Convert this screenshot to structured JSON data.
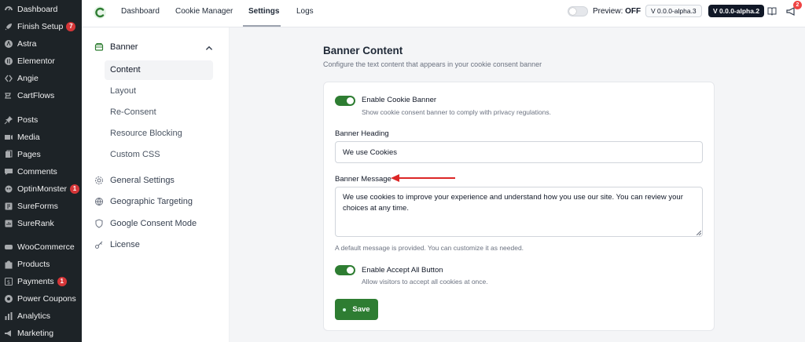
{
  "wp_sidebar": {
    "items": [
      {
        "label": "Dashboard",
        "icon": "dashboard-icon"
      },
      {
        "label": "Finish Setup",
        "icon": "rocket-icon",
        "badge": "7"
      },
      {
        "label": "Astra",
        "icon": "astra-icon"
      },
      {
        "label": "Elementor",
        "icon": "elementor-icon"
      },
      {
        "label": "Angie",
        "icon": "angie-icon"
      },
      {
        "label": "CartFlows",
        "icon": "cartflows-icon"
      },
      {
        "label": "Posts",
        "icon": "pin-icon"
      },
      {
        "label": "Media",
        "icon": "media-icon"
      },
      {
        "label": "Pages",
        "icon": "pages-icon"
      },
      {
        "label": "Comments",
        "icon": "comment-icon"
      },
      {
        "label": "OptinMonster",
        "icon": "optinmonster-icon",
        "badge": "1"
      },
      {
        "label": "SureForms",
        "icon": "sureforms-icon"
      },
      {
        "label": "SureRank",
        "icon": "surerank-icon"
      },
      {
        "label": "WooCommerce",
        "icon": "woocommerce-icon"
      },
      {
        "label": "Products",
        "icon": "products-icon"
      },
      {
        "label": "Payments",
        "icon": "payments-icon",
        "badge": "1"
      },
      {
        "label": "Power Coupons",
        "icon": "coupon-icon"
      },
      {
        "label": "Analytics",
        "icon": "analytics-icon"
      },
      {
        "label": "Marketing",
        "icon": "megaphone-icon"
      }
    ]
  },
  "topbar": {
    "tabs": [
      "Dashboard",
      "Cookie Manager",
      "Settings",
      "Logs"
    ],
    "active_tab": "Settings",
    "preview_label": "Preview:",
    "preview_state": "OFF",
    "version_current": "V 0.0.0-alpha.3",
    "version_latest": "V 0.0.0-alpha.2",
    "notification_count": "2"
  },
  "settings_nav": {
    "group": {
      "label": "Banner",
      "icon": "banner-icon"
    },
    "sub_items": [
      "Content",
      "Layout",
      "Re-Consent",
      "Resource Blocking",
      "Custom CSS"
    ],
    "active_sub": "Content",
    "items": [
      {
        "label": "General Settings",
        "icon": "gear-icon"
      },
      {
        "label": "Geographic Targeting",
        "icon": "globe-icon"
      },
      {
        "label": "Google Consent Mode",
        "icon": "shield-icon"
      },
      {
        "label": "License",
        "icon": "key-icon"
      }
    ]
  },
  "main": {
    "title": "Banner Content",
    "description": "Configure the text content that appears in your cookie consent banner",
    "enable_banner": {
      "label": "Enable Cookie Banner",
      "help": "Show cookie consent banner to comply with privacy regulations.",
      "on": true
    },
    "heading": {
      "label": "Banner Heading",
      "value": "We use Cookies"
    },
    "message": {
      "label": "Banner Message",
      "value": "We use cookies to improve your experience and understand how you use our site. You can review your choices at any time.",
      "help": "A default message is provided. You can customize it as needed."
    },
    "accept_all": {
      "label": "Enable Accept All Button",
      "help": "Allow visitors to accept all cookies at once.",
      "on": true
    },
    "save_label": "Save"
  },
  "colors": {
    "accent": "#2e7d32",
    "annotation_arrow": "#dc2626",
    "wp_sidebar": "#1d2327",
    "badge": "#d63638"
  }
}
